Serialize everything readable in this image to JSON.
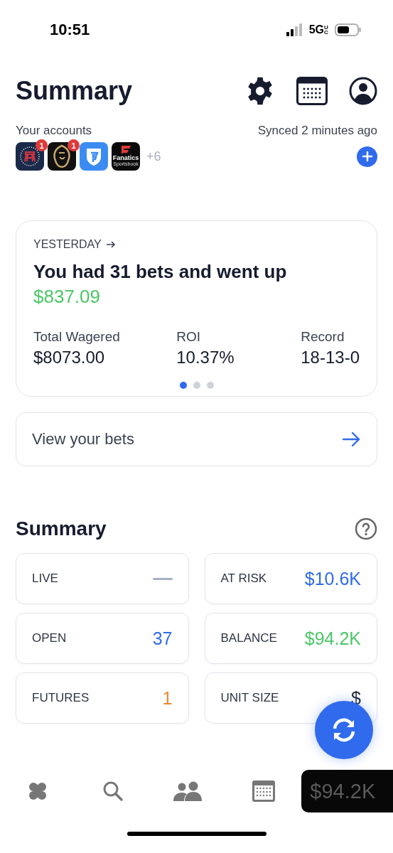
{
  "status_bar": {
    "time": "10:51",
    "network": "5G",
    "network_sup": "UC"
  },
  "header": {
    "title": "Summary"
  },
  "accounts": {
    "label": "Your accounts",
    "synced": "Synced 2 minutes ago",
    "more": "+6",
    "items": [
      {
        "kind": "barstool",
        "badge": "1"
      },
      {
        "kind": "lion",
        "badge": "1"
      },
      {
        "kind": "shield"
      },
      {
        "kind": "fanatics",
        "name": "Fanatics",
        "sub": "Sportsbook"
      }
    ]
  },
  "yesterday": {
    "label": "YESTERDAY",
    "headline": "You had 31 bets and went up",
    "amount": "$837.09",
    "stats": [
      {
        "label": "Total Wagered",
        "value": "$8073.00"
      },
      {
        "label": "ROI",
        "value": "10.37%"
      },
      {
        "label": "Record",
        "value": "18-13-0"
      }
    ],
    "pages": [
      {
        "selected": true
      },
      {
        "selected": false
      },
      {
        "selected": false
      }
    ]
  },
  "view_bets": {
    "label": "View your bets"
  },
  "summary": {
    "title": "Summary",
    "tiles": [
      {
        "label": "LIVE",
        "kind": "dash"
      },
      {
        "label": "AT RISK",
        "value": "$10.6K",
        "color": "#2f6bec"
      },
      {
        "label": "OPEN",
        "value": "37",
        "color": "#2f6bec"
      },
      {
        "label": "BALANCE",
        "value": "$94.2K",
        "color": "#4cc766"
      },
      {
        "label": "FUTURES",
        "value": "1",
        "color": "#ee8a2a"
      },
      {
        "label": "UNIT SIZE",
        "value": "$",
        "color": "#1c2333"
      }
    ]
  },
  "tab_bar": {
    "tabs": [
      {
        "kind": "clover"
      },
      {
        "kind": "search"
      },
      {
        "kind": "people"
      },
      {
        "kind": "calendar"
      },
      {
        "kind": "blob",
        "text": "$94.2K"
      }
    ]
  }
}
